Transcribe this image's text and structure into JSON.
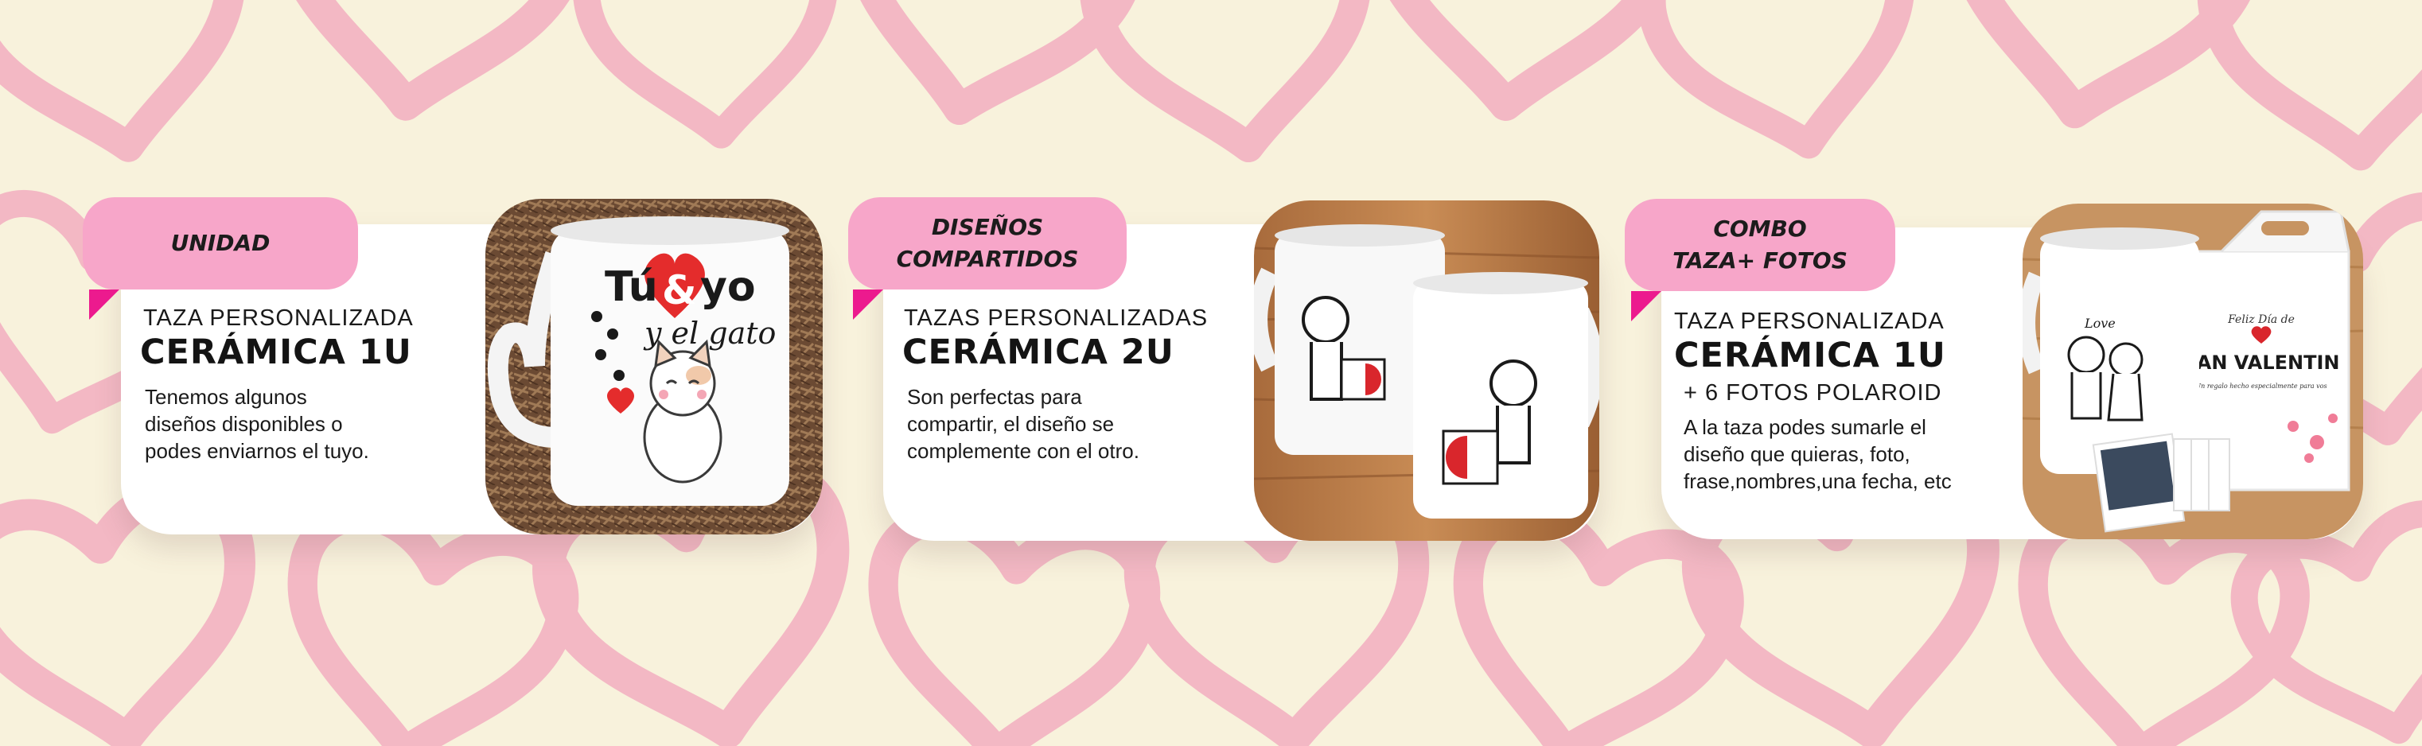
{
  "colors": {
    "background": "#f8f2dc",
    "hearts": "#f3b8c4",
    "tab": "#f7a6c9",
    "accent": "#ec1a8e"
  },
  "cards": [
    {
      "tab": "UNIDAD",
      "subtitle": "TAZA PERSONALIZADA",
      "title": "CERÁMICA 1U",
      "extra": "",
      "description": "Tenemos algunos\ndiseños disponibles o\npodes enviarnos el tuyo.",
      "photo": {
        "text_line1": "Tú",
        "text_amp": "&",
        "text_line1b": "yo",
        "text_line2": "y el gato"
      }
    },
    {
      "tab": "DISEÑOS\nCOMPARTIDOS",
      "subtitle": "TAZAS PERSONALIZADAS",
      "title": "CERÁMICA 2U",
      "extra": "",
      "description": "Son perfectas para\ncompartir, el diseño se\ncomplemente con el otro.",
      "photo": {}
    },
    {
      "tab": "COMBO\nTAZA+ FOTOS",
      "subtitle": "TAZA PERSONALIZADA",
      "title": "CERÁMICA 1U",
      "extra": "+ 6 FOTOS POLAROID",
      "description": "A la taza podes sumarle el\ndiseño que quieras, foto,\nfrase,nombres,una fecha, etc",
      "photo": {
        "mug_text": "Love",
        "box_top": "Feliz Día de",
        "box_title": "SAN VALENTIN",
        "box_small": "Un regalo hecho especialmente para vos"
      }
    }
  ]
}
